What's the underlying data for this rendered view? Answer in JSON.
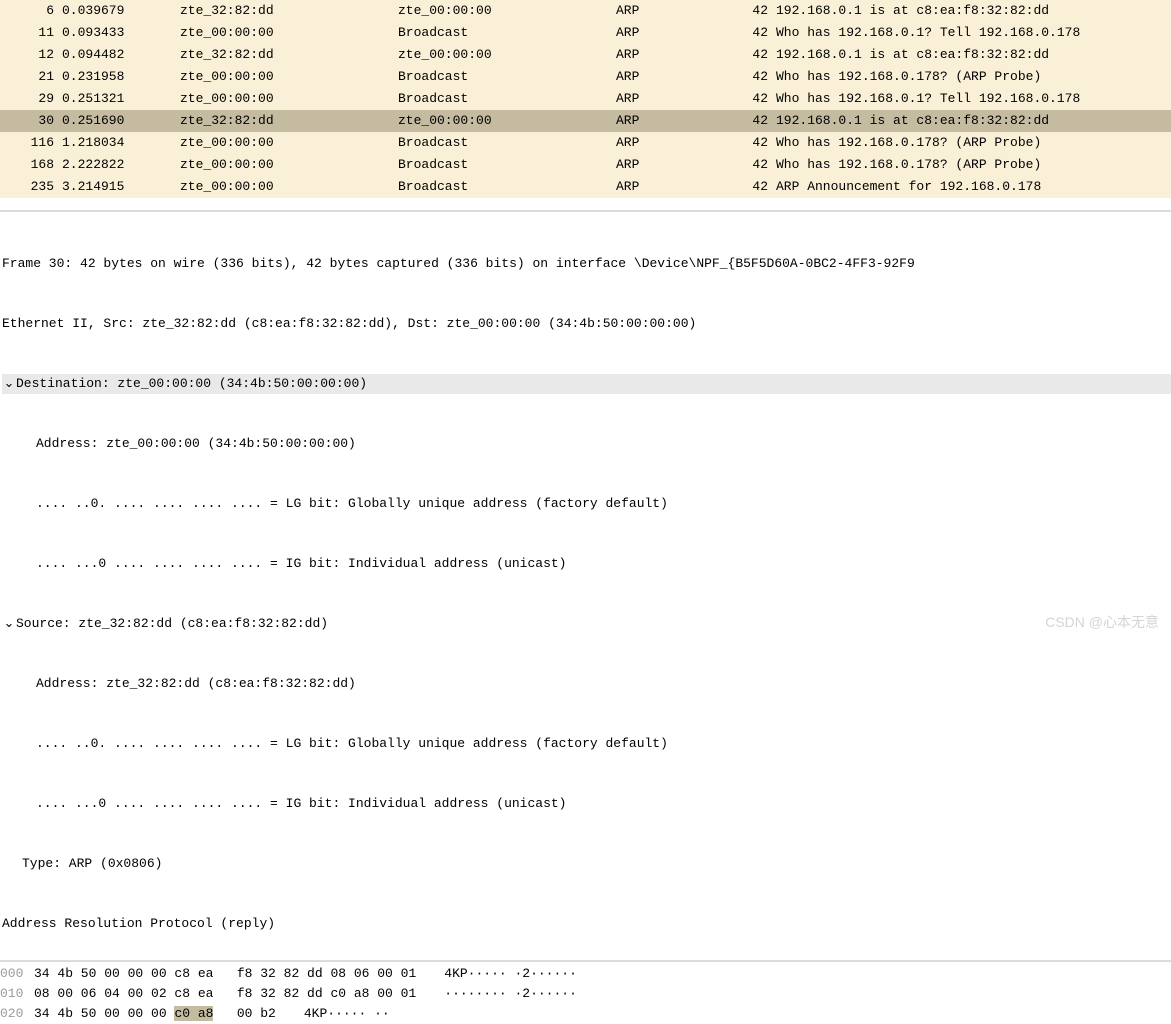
{
  "packet_list": {
    "rows": [
      {
        "no": "6",
        "time": "0.039679",
        "src": "zte_32:82:dd",
        "dst": "zte_00:00:00",
        "proto": "ARP",
        "len": "42",
        "info": "192.168.0.1 is at c8:ea:f8:32:82:dd",
        "selected": false
      },
      {
        "no": "11",
        "time": "0.093433",
        "src": "zte_00:00:00",
        "dst": "Broadcast",
        "proto": "ARP",
        "len": "42",
        "info": "Who has 192.168.0.1? Tell 192.168.0.178",
        "selected": false
      },
      {
        "no": "12",
        "time": "0.094482",
        "src": "zte_32:82:dd",
        "dst": "zte_00:00:00",
        "proto": "ARP",
        "len": "42",
        "info": "192.168.0.1 is at c8:ea:f8:32:82:dd",
        "selected": false
      },
      {
        "no": "21",
        "time": "0.231958",
        "src": "zte_00:00:00",
        "dst": "Broadcast",
        "proto": "ARP",
        "len": "42",
        "info": "Who has 192.168.0.178? (ARP Probe)",
        "selected": false
      },
      {
        "no": "29",
        "time": "0.251321",
        "src": "zte_00:00:00",
        "dst": "Broadcast",
        "proto": "ARP",
        "len": "42",
        "info": "Who has 192.168.0.1? Tell 192.168.0.178",
        "selected": false
      },
      {
        "no": "30",
        "time": "0.251690",
        "src": "zte_32:82:dd",
        "dst": "zte_00:00:00",
        "proto": "ARP",
        "len": "42",
        "info": "192.168.0.1 is at c8:ea:f8:32:82:dd",
        "selected": true
      },
      {
        "no": "116",
        "time": "1.218034",
        "src": "zte_00:00:00",
        "dst": "Broadcast",
        "proto": "ARP",
        "len": "42",
        "info": "Who has 192.168.0.178? (ARP Probe)",
        "selected": false
      },
      {
        "no": "168",
        "time": "2.222822",
        "src": "zte_00:00:00",
        "dst": "Broadcast",
        "proto": "ARP",
        "len": "42",
        "info": "Who has 192.168.0.178? (ARP Probe)",
        "selected": false
      },
      {
        "no": "235",
        "time": "3.214915",
        "src": "zte_00:00:00",
        "dst": "Broadcast",
        "proto": "ARP",
        "len": "42",
        "info": "ARP Announcement for 192.168.0.178",
        "selected": false
      }
    ]
  },
  "details": {
    "frame_line": "Frame 30: 42 bytes on wire (336 bits), 42 bytes captured (336 bits) on interface \\Device\\NPF_{B5F5D60A-0BC2-4FF3-92F9",
    "eth_line": "Ethernet II, Src: zte_32:82:dd (c8:ea:f8:32:82:dd), Dst: zte_00:00:00 (34:4b:50:00:00:00)",
    "dst_header": "Destination: zte_00:00:00 (34:4b:50:00:00:00)",
    "dst_addr": "Address: zte_00:00:00 (34:4b:50:00:00:00)",
    "lg_line": ".... ..0. .... .... .... .... = LG bit: Globally unique address (factory default)",
    "ig_line": ".... ...0 .... .... .... .... = IG bit: Individual address (unicast)",
    "src_header": "Source: zte_32:82:dd (c8:ea:f8:32:82:dd)",
    "src_addr": "Address: zte_32:82:dd (c8:ea:f8:32:82:dd)",
    "type_line": "Type: ARP (0x0806)",
    "arp_line": "Address Resolution Protocol (reply)"
  },
  "hex": {
    "rows": [
      {
        "offset": "000",
        "bytes_a": "34 4b 50 00 00 00 c8 ea",
        "bytes_b": "f8 32 82 dd 08 06 00 01",
        "ascii": "4KP····· ·2······"
      },
      {
        "offset": "010",
        "bytes_a": "08 00 06 04 00 02 c8 ea",
        "bytes_b": "f8 32 82 dd c0 a8 00 01",
        "ascii": "········ ·2······"
      },
      {
        "offset": "020",
        "bytes_a": "34 4b 50 00 00 00 ",
        "sel": "c0 a8",
        "bytes_b": "00 b2",
        "ascii": "4KP····· ··",
        "ascii_sel": ""
      }
    ]
  },
  "watermark": "CSDN @心本无意"
}
